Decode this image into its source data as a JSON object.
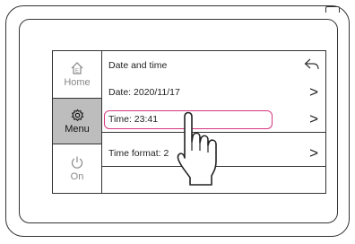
{
  "sidebar": {
    "items": [
      {
        "label": "Home",
        "icon": "home-icon",
        "selected": false
      },
      {
        "label": "Menu",
        "icon": "gear-icon",
        "selected": true
      },
      {
        "label": "On",
        "icon": "power-icon",
        "selected": false
      }
    ]
  },
  "screen": {
    "title": "Date and time",
    "back_icon": "back-arrow-icon",
    "rows": [
      {
        "label": "Date: 2020/11/17",
        "icon": "chevron-right-icon"
      },
      {
        "label": "Time: 23:41",
        "icon": "chevron-right-icon",
        "highlighted": true
      },
      {
        "label": "Time format: 2",
        "icon": "chevron-right-icon"
      }
    ]
  },
  "colors": {
    "highlight": "#d5377f",
    "selected_bg": "#bdbdbd",
    "outline": "#333333"
  },
  "pointer": {
    "icon": "tap-hand-icon"
  }
}
